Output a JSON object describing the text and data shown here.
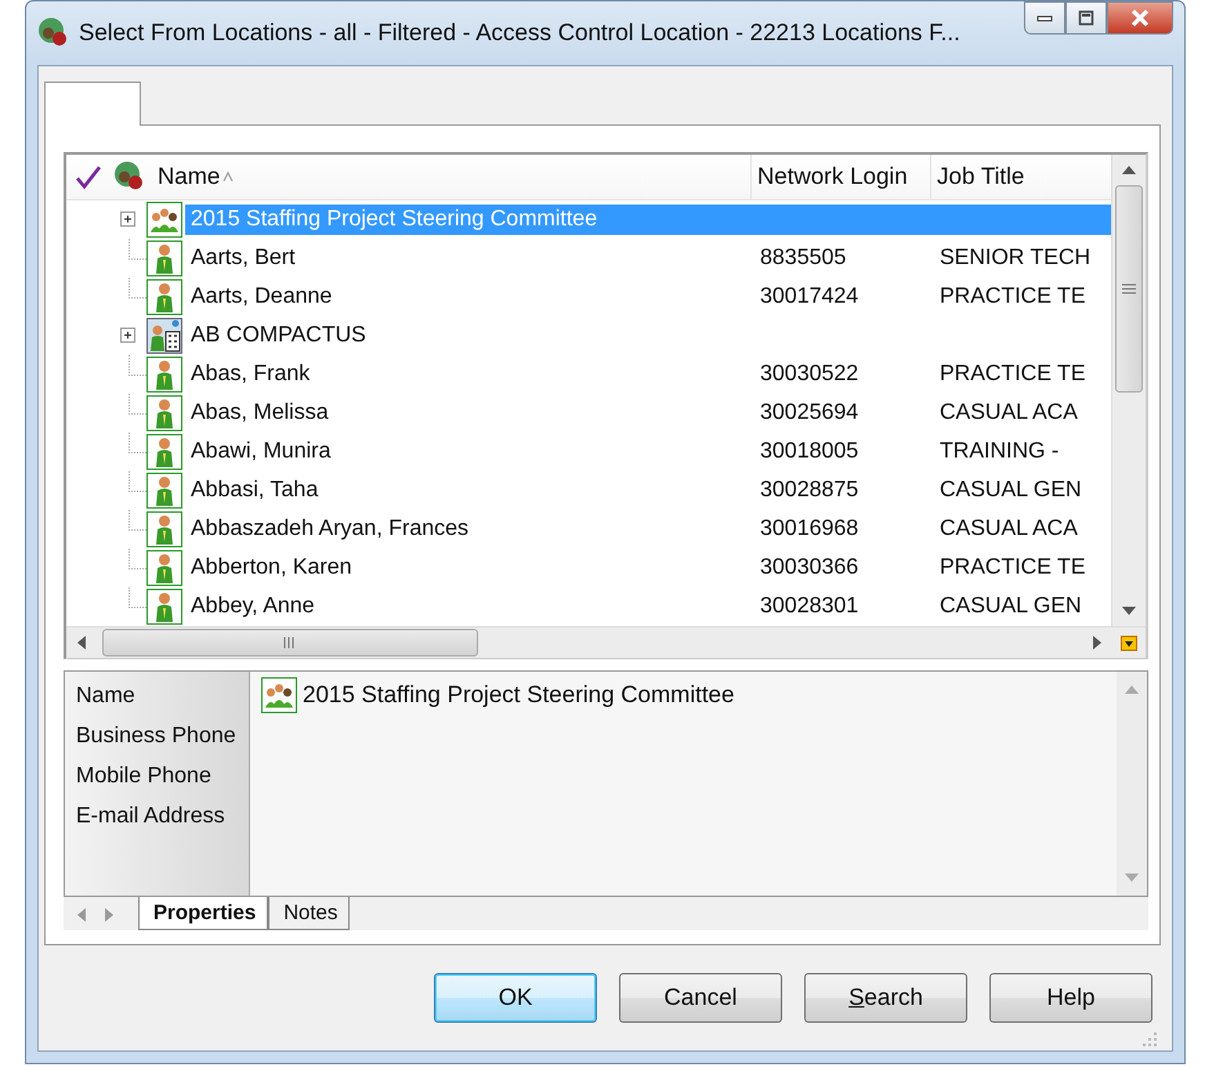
{
  "window": {
    "title": "Select From Locations - all - Filtered - Access Control Location - 22213 Locations F..."
  },
  "table": {
    "columns": [
      {
        "label": "Name",
        "sorted": true
      },
      {
        "label": "Network Login",
        "sorted": false
      },
      {
        "label": "Job Title",
        "sorted": false
      }
    ],
    "rows": [
      {
        "kind": "group",
        "expanded": false,
        "selected": true,
        "name": "2015 Staffing Project Steering Committee"
      },
      {
        "kind": "person",
        "selected": false,
        "name": "Aarts, Bert",
        "login": "8835505",
        "job": "SENIOR TECH"
      },
      {
        "kind": "person",
        "selected": false,
        "name": "Aarts, Deanne",
        "login": "30017424",
        "job": "PRACTICE TE"
      },
      {
        "kind": "organisation",
        "expanded": false,
        "selected": false,
        "name": "AB COMPACTUS"
      },
      {
        "kind": "person",
        "selected": false,
        "name": "Abas, Frank",
        "login": "30030522",
        "job": "PRACTICE TE"
      },
      {
        "kind": "person",
        "selected": false,
        "name": "Abas, Melissa",
        "login": "30025694",
        "job": "CASUAL ACA"
      },
      {
        "kind": "person",
        "selected": false,
        "name": "Abawi, Munira",
        "login": "30018005",
        "job": "TRAINING -"
      },
      {
        "kind": "person",
        "selected": false,
        "name": "Abbasi, Taha",
        "login": "30028875",
        "job": "CASUAL GEN"
      },
      {
        "kind": "person",
        "selected": false,
        "name": "Abbaszadeh Aryan, Frances",
        "login": "30016968",
        "job": "CASUAL ACA"
      },
      {
        "kind": "person",
        "selected": false,
        "name": "Abberton, Karen",
        "login": "30030366",
        "job": "PRACTICE TE"
      },
      {
        "kind": "person",
        "selected": false,
        "name": "Abbey, Anne",
        "login": "30028301",
        "job": "CASUAL GEN"
      }
    ]
  },
  "details": {
    "labels": [
      "Name",
      "Business Phone",
      "Mobile Phone",
      "E-mail Address"
    ],
    "value": {
      "kind": "group",
      "text": "2015 Staffing Project Steering Committee"
    }
  },
  "detail_tabs": [
    {
      "label": "Properties",
      "selected": true
    },
    {
      "label": "Notes",
      "selected": false
    }
  ],
  "buttons": [
    {
      "label": "OK",
      "default": true
    },
    {
      "label": "Cancel",
      "default": false
    },
    {
      "label": "Search",
      "default": false,
      "accesskey_underlined": true
    },
    {
      "label": "Help",
      "default": false
    }
  ]
}
